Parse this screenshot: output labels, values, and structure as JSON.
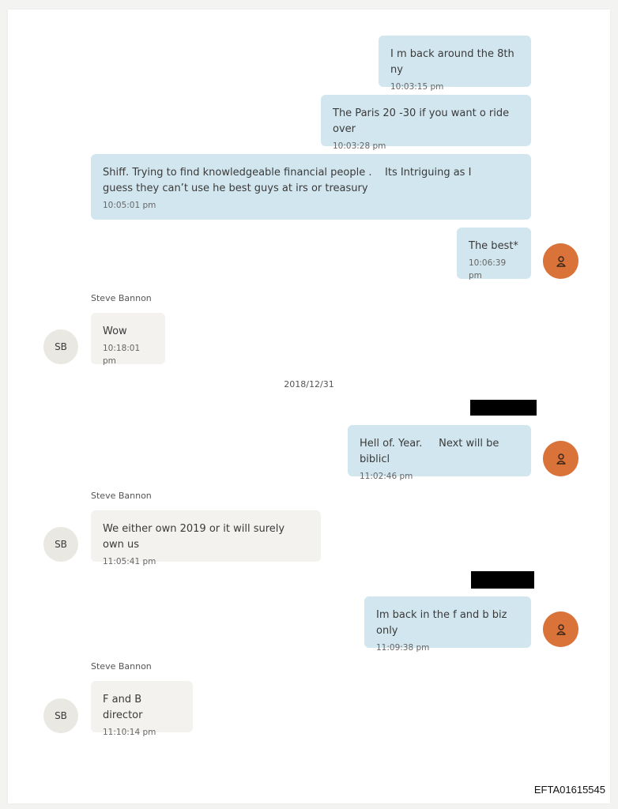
{
  "thread": {
    "messages": [
      {
        "text": "I m back around the 8th ny",
        "time": "10:03:15 pm"
      },
      {
        "text": "The Paris 20 -30 if you want o ride over",
        "time": "10:03:28 pm"
      },
      {
        "text": "Shiff. Trying to find knowledgeable financial people .    Its Intriguing as I guess they can’t use he best guys at irs or treasury",
        "time": "10:05:01 pm"
      },
      {
        "text": "The best*",
        "time": "10:06:39 pm"
      },
      {
        "sender": "Steve Bannon",
        "initials": "SB",
        "text": "Wow",
        "time": "10:18:01 pm"
      },
      {
        "text": "Hell of. Year.     Next will be biblicl",
        "time": "11:02:46 pm"
      },
      {
        "sender": "Steve Bannon",
        "initials": "SB",
        "text": "We either own 2019 or it will surely own us",
        "time": "11:05:41 pm"
      },
      {
        "text": "Im back in the f and b biz only",
        "time": "11:09:38 pm"
      },
      {
        "sender": "Steve Bannon",
        "initials": "SB",
        "text": "F and B director",
        "time": "11:10:14 pm"
      }
    ],
    "date_separator": "2018/12/31"
  },
  "colors": {
    "outgoing_bubble": "#d2e6ef",
    "incoming_bubble": "#f3f2ef",
    "self_avatar": "#d9733a",
    "contact_avatar": "#eae8e2",
    "redaction": "#000000"
  },
  "icons": {
    "self_avatar": "user-icon"
  },
  "footer": {
    "doc_id": "EFTA01615545"
  }
}
